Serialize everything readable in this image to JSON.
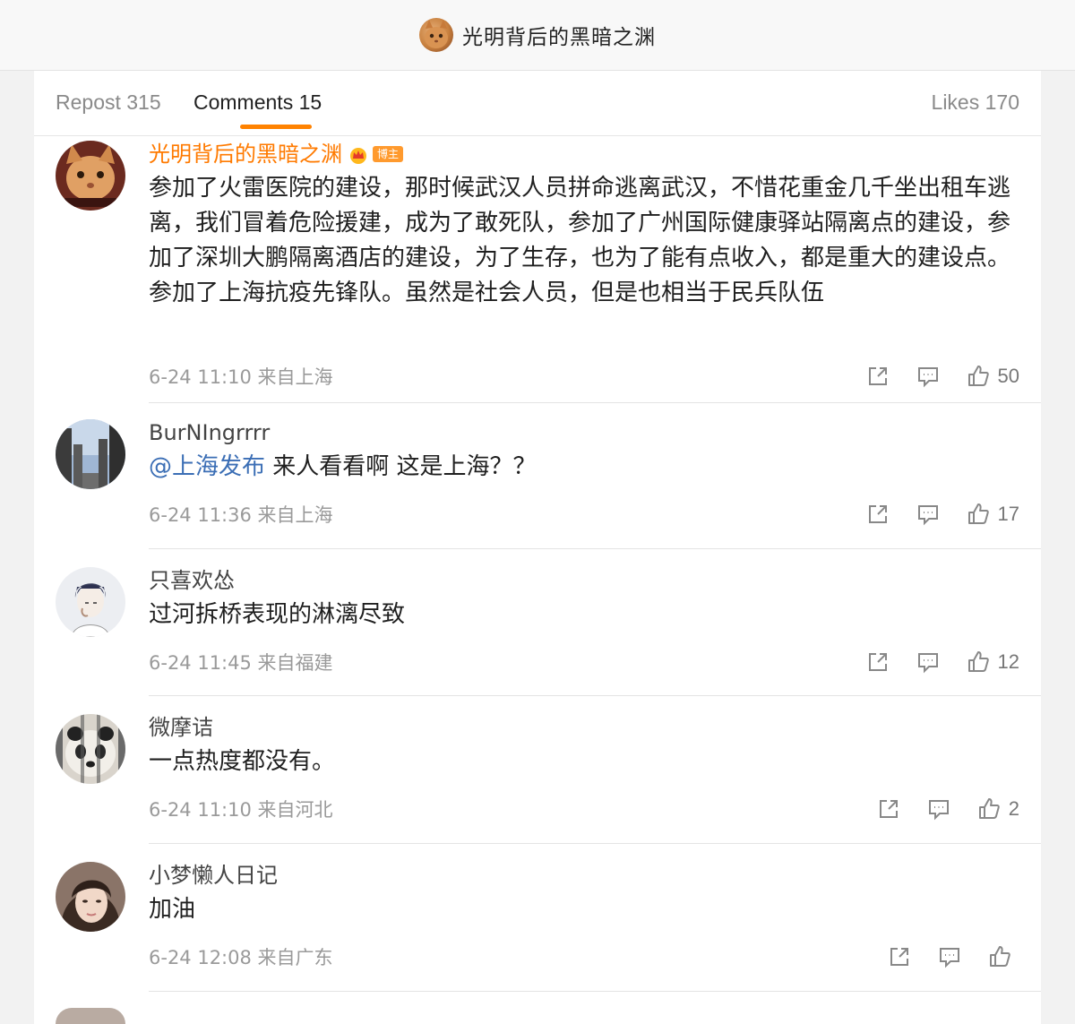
{
  "header": {
    "title": "光明背后的黑暗之渊"
  },
  "tabs": {
    "repost": "Repost 315",
    "comments": "Comments 15",
    "likes": "Likes 170"
  },
  "colors": {
    "accent": "#ff8200",
    "author_name": "#ff7a00",
    "mention": "#3b6eb5"
  },
  "comments": [
    {
      "user": "光明背后的黑暗之渊",
      "is_author": true,
      "badge": "博主",
      "text": "参加了火雷医院的建设，那时候武汉人员拼命逃离武汉，不惜花重金几千坐出租车逃离，我们冒着危险援建，成为了敢死队，参加了广州国际健康驿站隔离点的建设，参加了深圳大鹏隔离酒店的建设，为了生存，也为了能有点收入，都是重大的建设点。参加了上海抗疫先锋队。虽然是社会人员，但是也相当于民兵队伍",
      "time": "6-24 11:10 来自上海",
      "likes": "50"
    },
    {
      "user": "BurNIngrrrr",
      "mention": "@上海发布",
      "text": "来人看看啊 这是上海？？",
      "time": "6-24 11:36 来自上海",
      "likes": "17"
    },
    {
      "user": "只喜欢怂",
      "text": "过河拆桥表现的淋漓尽致",
      "time": "6-24 11:45 来自福建",
      "likes": "12"
    },
    {
      "user": "微摩诘",
      "text": "一点热度都没有。",
      "time": "6-24 11:10 来自河北",
      "likes": "2"
    },
    {
      "user": "小梦懒人日记",
      "text": "加油",
      "time": "6-24 12:08 来自广东",
      "likes": ""
    }
  ]
}
